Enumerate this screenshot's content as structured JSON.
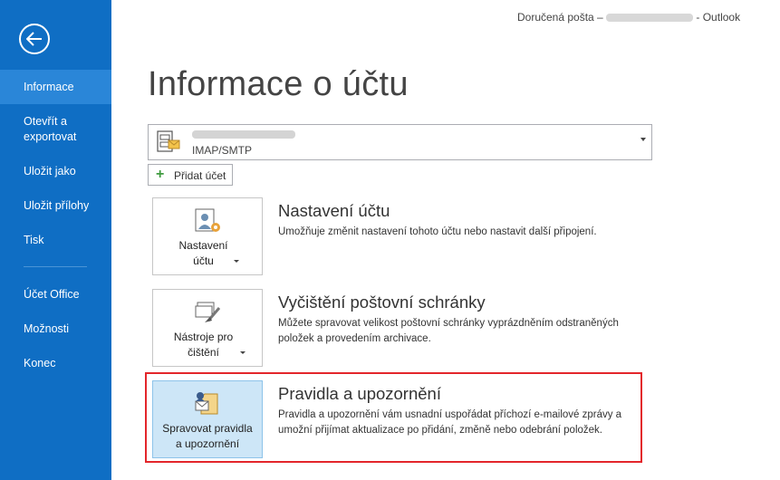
{
  "window": {
    "title_prefix": "Doručená pošta – ",
    "title_suffix": " - Outlook"
  },
  "sidebar": {
    "back_icon": "back-arrow-icon",
    "items": [
      {
        "label": "Informace",
        "active": true
      },
      {
        "label": "Otevřít a exportovat"
      },
      {
        "label": "Uložit jako"
      },
      {
        "label": "Uložit přílohy"
      },
      {
        "label": "Tisk"
      },
      {
        "label": "Účet Office"
      },
      {
        "label": "Možnosti"
      },
      {
        "label": "Konec"
      }
    ]
  },
  "main": {
    "title": "Informace o účtu",
    "account": {
      "type": "IMAP/SMTP"
    },
    "add_account": "Přidat účet",
    "sections": [
      {
        "button": "Nastavení účtu",
        "title": "Nastavení účtu",
        "desc": "Umožňuje změnit nastavení tohoto účtu nebo nastavit další připojení."
      },
      {
        "button": "Nástroje pro čištění",
        "title": "Vyčištění poštovní schránky",
        "desc": "Můžete spravovat velikost poštovní schránky vyprázdněním odstraněných položek a provedením archivace."
      },
      {
        "button": "Spravovat pravidla a upozornění",
        "title": "Pravidla a upozornění",
        "desc": "Pravidla a upozornění vám usnadní uspořádat příchozí e-mailové zprávy a umožní přijímat aktualizace po přidání, změně nebo odebrání položek."
      }
    ]
  },
  "colors": {
    "sidebar": "#0f6ec4",
    "sidebar_active": "#2a86d8",
    "tile_selected": "#cde6f7",
    "highlight": "#e3262b"
  }
}
